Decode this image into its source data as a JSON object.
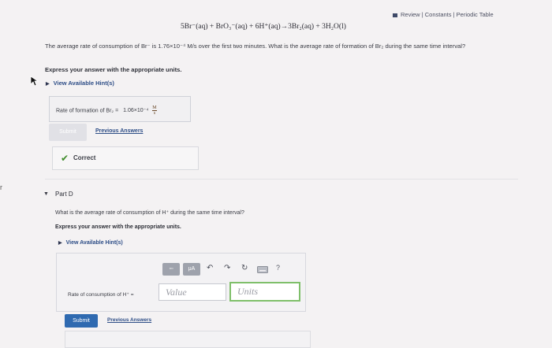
{
  "header": {
    "review_link": "Review",
    "constants_link": "Constants",
    "periodic_link": "Periodic Table",
    "separator": "|"
  },
  "part_c": {
    "equation": "5Br⁻(aq) + BrO₃⁻(aq) + 6H⁺(aq)→3Br₂(aq) + 3H₂O(l)",
    "question": "The average rate of consumption of Br⁻ is 1.76×10⁻⁴ M/s over the first two minutes. What is the average rate of formation of Br₂ during the same time interval?",
    "instruction": "Express your answer with the appropriate units.",
    "hint_label": "View Available Hint(s)",
    "answer_label": "Rate of formation of Br₂ =",
    "answer_value": "1.06×10⁻⁴",
    "answer_unit_num": "M",
    "answer_unit_den": "s",
    "submit_label": "Submit",
    "previous_answers_label": "Previous Answers",
    "correct_label": "Correct"
  },
  "part_d": {
    "title": "Part D",
    "question": "What is the average rate of consumption of H⁺ during the same time interval?",
    "instruction": "Express your answer with the appropriate units.",
    "hint_label": "View Available Hint(s)",
    "toolbar": {
      "templates_label": "▫▫",
      "units_label": "μA",
      "help_label": "?"
    },
    "rate_label": "Rate of consumption of H⁺ =",
    "value_placeholder": "Value",
    "units_placeholder": "Units",
    "submit_label": "Submit",
    "previous_answers_label": "Previous Answers"
  },
  "edge_char": "r",
  "icons": {
    "check": "checkmark-icon",
    "undo": "undo-icon",
    "redo": "redo-icon",
    "reset": "reset-icon",
    "keyboard": "keyboard-icon"
  },
  "colors": {
    "link": "#2e4e87",
    "correct": "#3f8b2a",
    "submit": "#2f6ab0",
    "units_border": "#7fbf6a"
  }
}
